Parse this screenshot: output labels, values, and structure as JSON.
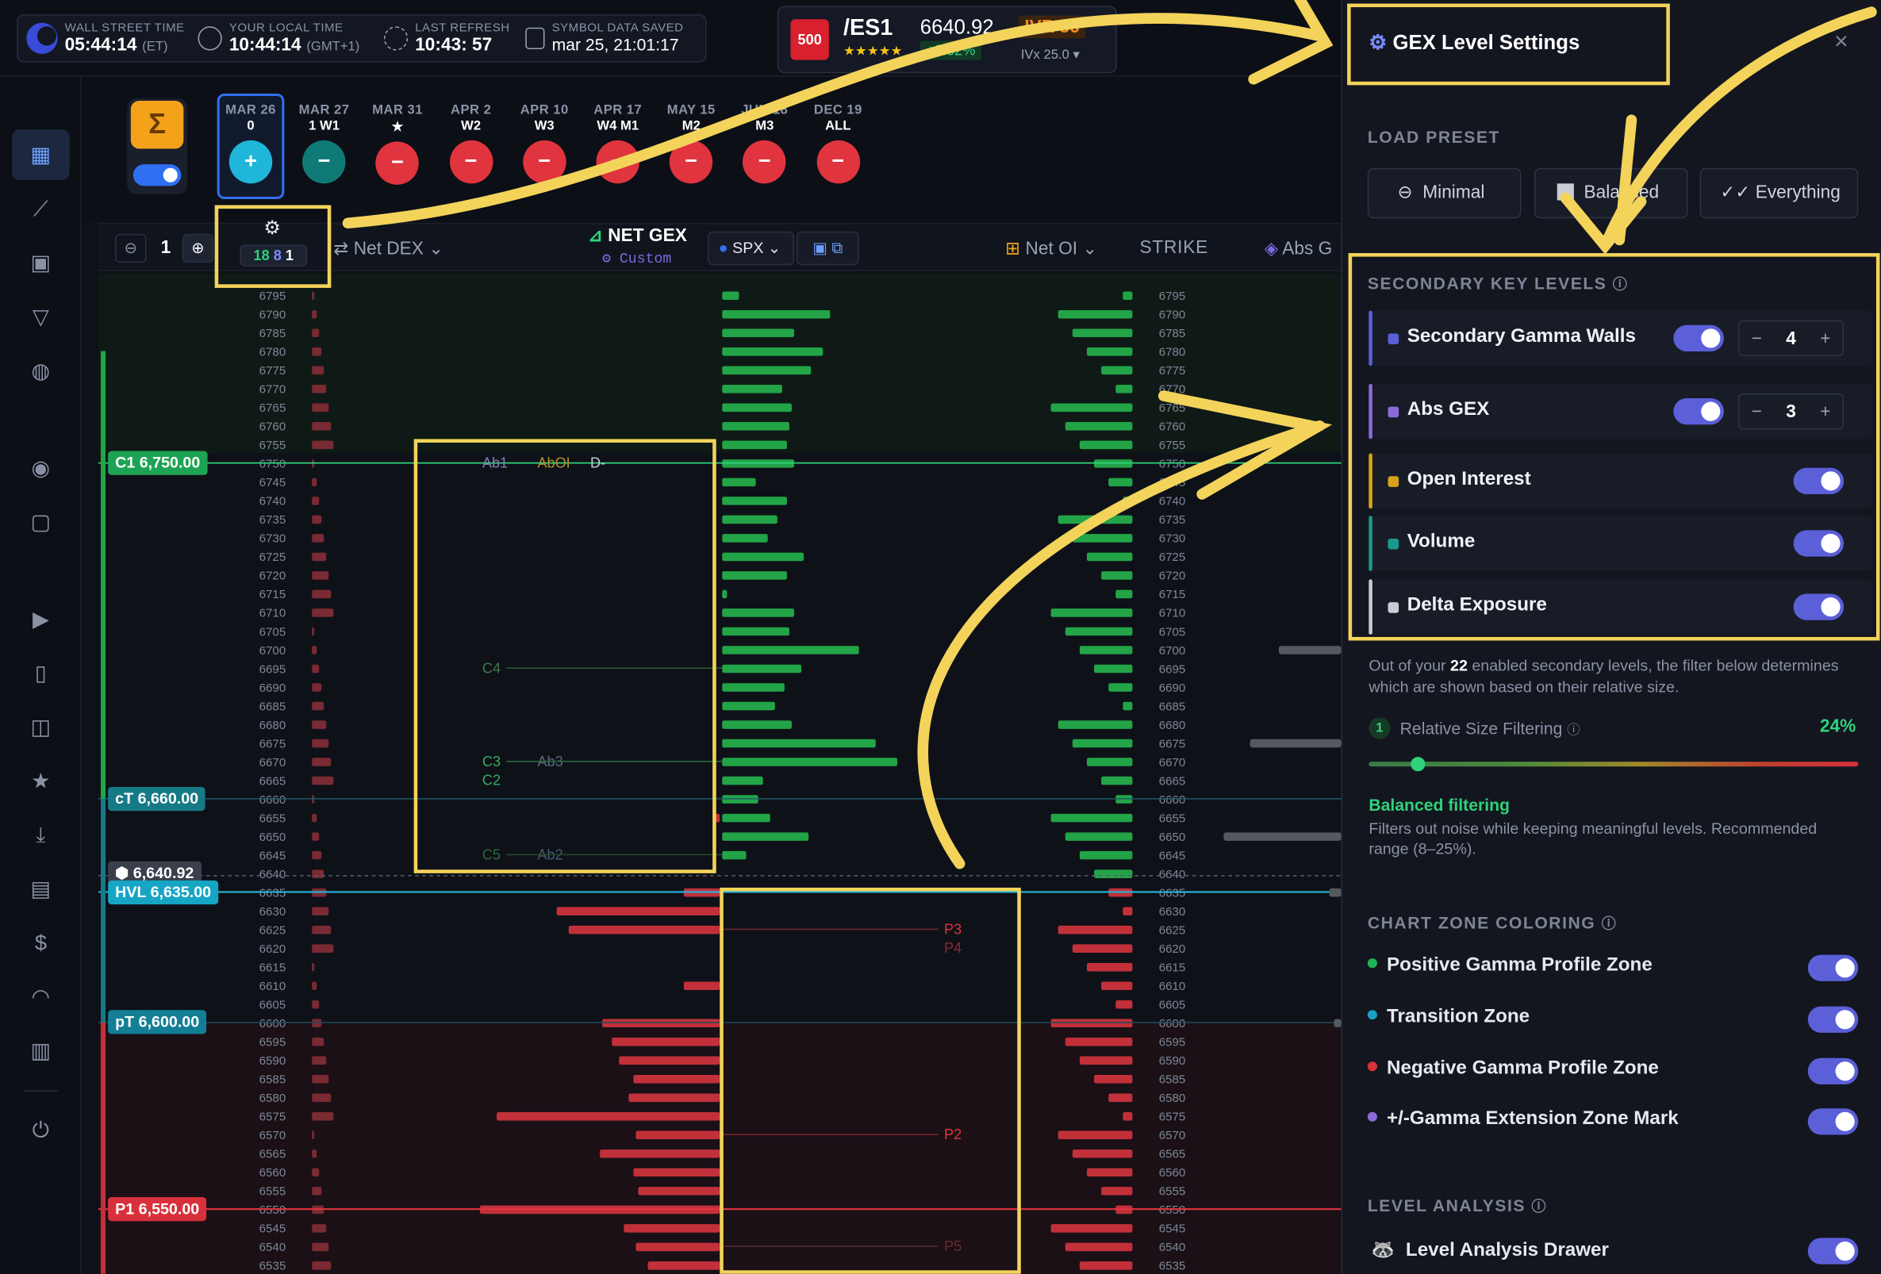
{
  "topbar": {
    "wall_street_label": "WALL STREET TIME",
    "wall_street_time": "05:44:14",
    "wall_street_tz": "(ET)",
    "local_label": "YOUR LOCAL TIME",
    "local_time": "10:44:14",
    "local_tz": "(GMT+1)",
    "refresh_label": "LAST REFRESH",
    "refresh_time": "10:43: 57",
    "saved_label": "SYMBOL DATA SAVED",
    "saved_time": "mar 25, 21:01:17",
    "ticker_badge": "500",
    "ticker_symbol": "/ES1",
    "ticker_stars": "★★★★★",
    "ticker_price": "6640.92",
    "ticker_change": "+0.52%",
    "ivr": "IVR 36",
    "ivx": "IVx 25.0 ▾"
  },
  "expiries": [
    {
      "date": "MAR 26",
      "sub": "0",
      "sign": "+",
      "color": "#1fb6d9",
      "active": true
    },
    {
      "date": "MAR 27",
      "sub": "1  W1",
      "sign": "−",
      "color": "#0f7a75",
      "active": false
    },
    {
      "date": "MAR 31",
      "sub": "★",
      "sign": "−",
      "color": "#e0343e",
      "active": false
    },
    {
      "date": "APR 2",
      "sub": "W2",
      "sign": "−",
      "color": "#e0343e",
      "active": false
    },
    {
      "date": "APR 10",
      "sub": "W3",
      "sign": "−",
      "color": "#e0343e",
      "active": false
    },
    {
      "date": "APR 17",
      "sub": "W4  M1",
      "sign": "−",
      "color": "#e0343e",
      "active": false
    },
    {
      "date": "MAY 15",
      "sub": "M2",
      "sign": "−",
      "color": "#e0343e",
      "active": false
    },
    {
      "date": "JUN 18",
      "sub": "M3",
      "sign": "−",
      "color": "#e0343e",
      "active": false
    },
    {
      "date": "DEC 19",
      "sub": "ALL",
      "sign": "−",
      "color": "#e0343e",
      "active": false
    }
  ],
  "chart_header": {
    "zoom_value": "1",
    "counts": [
      "18",
      "8",
      "1"
    ],
    "net_dex": "Net DEX",
    "net_gex": "NET GEX",
    "custom": "Custom",
    "symbol": "SPX",
    "net_oi": "Net OI",
    "strike": "STRIKE",
    "abs_g": "Abs G"
  },
  "strikes": [
    "6795",
    "6790",
    "6785",
    "6780",
    "6775",
    "6770",
    "6765",
    "6760",
    "6755",
    "6750",
    "6745",
    "6740",
    "6735",
    "6730",
    "6725",
    "6720",
    "6715",
    "6710",
    "6705",
    "6700",
    "6695",
    "6690",
    "6685",
    "6680",
    "6675",
    "6670",
    "6665",
    "6660",
    "6655",
    "6650",
    "6645",
    "6640",
    "6635",
    "6630",
    "6625",
    "6620",
    "6615",
    "6610",
    "6605",
    "6600",
    "6595",
    "6590",
    "6585",
    "6580",
    "6575",
    "6570",
    "6565",
    "6560",
    "6555",
    "6550",
    "6545",
    "6540",
    "6535"
  ],
  "level_tags": [
    {
      "label": "C1 6,750.00",
      "strike_index": 9,
      "color": "#1ea354",
      "name": "level-tag-c1"
    },
    {
      "label": "cT 6,660.00",
      "strike_index": 27,
      "color": "#167a86",
      "name": "level-tag-ct"
    },
    {
      "label": "⬢ 6,640.92",
      "strike_index": 31,
      "color": "#3a3f4c",
      "name": "level-tag-price"
    },
    {
      "label": "HVL 6,635.00",
      "strike_index": 32,
      "color": "#16a5c4",
      "name": "level-tag-hvl"
    },
    {
      "label": "pT 6,600.00",
      "strike_index": 39,
      "color": "#147e95",
      "name": "level-tag-pt"
    },
    {
      "label": "P1 6,550.00",
      "strike_index": 49,
      "color": "#d8313b",
      "name": "level-tag-p1"
    }
  ],
  "chart_labels": {
    "ab1": "Ab1",
    "aboi": "AbOI",
    "dminus": "D-",
    "c4": "C4",
    "c3": "C3",
    "c2": "C2",
    "ab3": "Ab3",
    "c5": "C5",
    "ab2": "Ab2",
    "p3": "P3",
    "p4": "P4",
    "p2": "P2",
    "p5": "P5"
  },
  "panel": {
    "title": "GEX Level Settings",
    "close": "×",
    "load_preset": "LOAD PRESET",
    "presets": [
      "Minimal",
      "Balanced",
      "Everything"
    ],
    "secondary_header": "SECONDARY KEY LEVELS",
    "secondary": [
      {
        "label": "Secondary Gamma Walls",
        "color": "#5b5fd8",
        "stepper": "4"
      },
      {
        "label": "Abs GEX",
        "color": "#8b6ad8",
        "stepper": "3"
      },
      {
        "label": "Open Interest",
        "color": "#d8a31a",
        "stepper": null
      },
      {
        "label": "Volume",
        "color": "#1a9a8a",
        "stepper": null
      },
      {
        "label": "Delta Exposure",
        "color": "#c9ccd3",
        "stepper": null
      }
    ],
    "filter_note_pre": "Out of your ",
    "filter_note_count": "22",
    "filter_note_post": " enabled secondary levels, the filter below determines which are shown based on their relative size.",
    "rsf_num": "1",
    "rsf_label": "Relative Size Filtering",
    "rsf_value": "24%",
    "rsf_level": 0.24,
    "balanced_title": "Balanced filtering",
    "balanced_desc": "Filters out noise while keeping meaningful levels. Recommended range (8–25%).",
    "zone_header": "CHART ZONE COLORING",
    "zones": [
      {
        "label": "Positive Gamma Profile Zone",
        "color": "#21b357"
      },
      {
        "label": "Transition Zone",
        "color": "#1a9ec4"
      },
      {
        "label": "Negative Gamma Profile Zone",
        "color": "#d8313b"
      },
      {
        "label": "+/-Gamma Extension Zone Mark",
        "color": "#8b6ad8"
      }
    ],
    "analysis_header": "LEVEL ANALYSIS",
    "analysis_item": "Level Analysis Drawer"
  }
}
